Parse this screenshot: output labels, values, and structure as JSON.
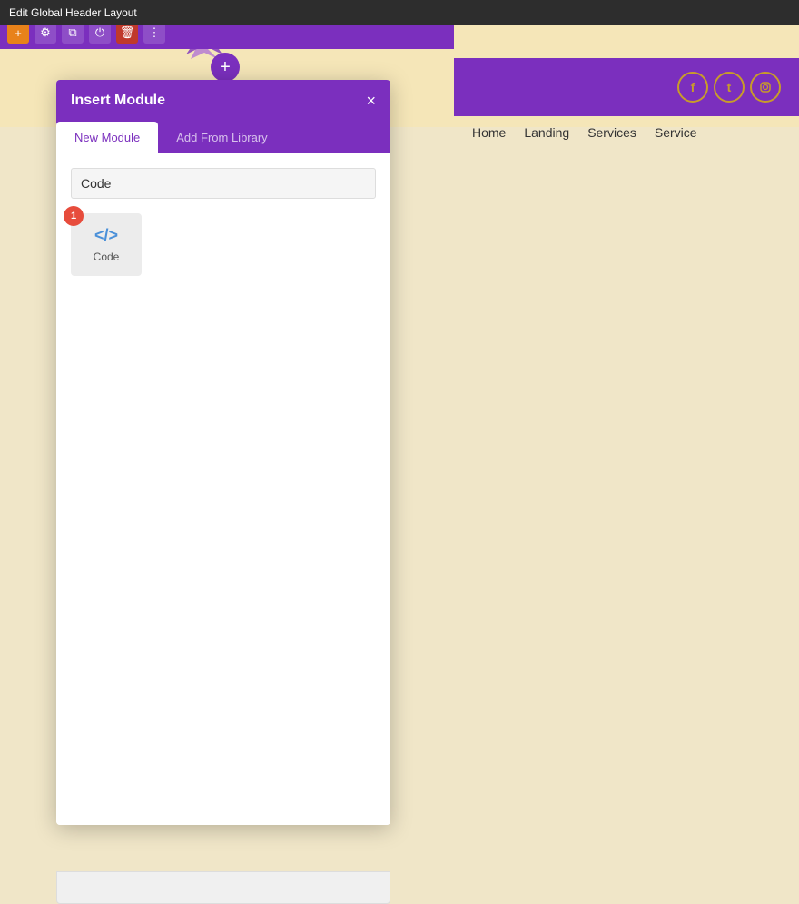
{
  "admin_bar": {
    "title": "Edit Global Header Layout"
  },
  "toolbar": {
    "buttons": [
      {
        "icon": "+",
        "type": "add",
        "color": "orange"
      },
      {
        "icon": "⚙",
        "type": "settings",
        "color": "default"
      },
      {
        "icon": "⧉",
        "type": "duplicate",
        "color": "default"
      },
      {
        "icon": "⏻",
        "type": "power",
        "color": "default"
      },
      {
        "icon": "🗑",
        "type": "delete",
        "color": "red"
      },
      {
        "icon": "⋮",
        "type": "more",
        "color": "default"
      }
    ]
  },
  "add_module_button": {
    "icon": "+"
  },
  "social_icons": [
    {
      "name": "facebook",
      "symbol": "f"
    },
    {
      "name": "twitter",
      "symbol": "t"
    },
    {
      "name": "instagram",
      "symbol": "ig"
    }
  ],
  "nav_links": [
    {
      "label": "Home"
    },
    {
      "label": "Landing"
    },
    {
      "label": "Services"
    },
    {
      "label": "Service"
    }
  ],
  "dialog": {
    "title": "Insert Module",
    "close_label": "×",
    "tabs": [
      {
        "label": "New Module",
        "active": true
      },
      {
        "label": "Add From Library",
        "active": false
      }
    ],
    "search": {
      "placeholder": "Code",
      "value": "Code"
    },
    "result_count": "1",
    "modules": [
      {
        "icon": "</>",
        "label": "Code"
      }
    ]
  }
}
